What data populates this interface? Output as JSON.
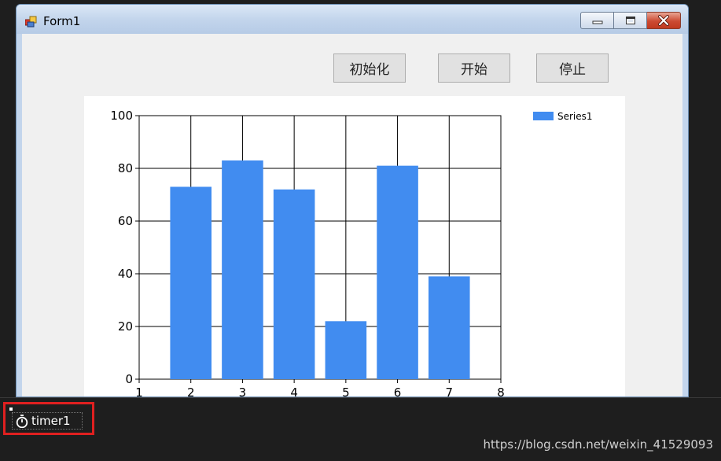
{
  "window": {
    "title": "Form1",
    "icon": "winforms-app-icon",
    "controls": [
      "minimize-icon",
      "maximize-icon",
      "close-icon"
    ]
  },
  "toolbar": {
    "init_label": "初始化",
    "start_label": "开始",
    "stop_label": "停止"
  },
  "chart_data": {
    "type": "bar",
    "x": [
      2,
      3,
      4,
      5,
      6,
      7
    ],
    "series": [
      {
        "name": "Series1",
        "values": [
          73,
          83,
          72,
          22,
          81,
          39
        ],
        "color": "#418cf0"
      }
    ],
    "xlim": [
      1,
      8
    ],
    "ylim": [
      0,
      100
    ],
    "x_ticks": [
      "1",
      "2",
      "3",
      "4",
      "5",
      "6",
      "7",
      "8"
    ],
    "y_ticks": [
      "0",
      "20",
      "40",
      "60",
      "80",
      "100"
    ],
    "grid": true,
    "legend_position": "top-right"
  },
  "tray": {
    "component_label": "timer1",
    "component_icon": "stopwatch-icon"
  },
  "watermark": "https://blog.csdn.net/weixin_41529093"
}
